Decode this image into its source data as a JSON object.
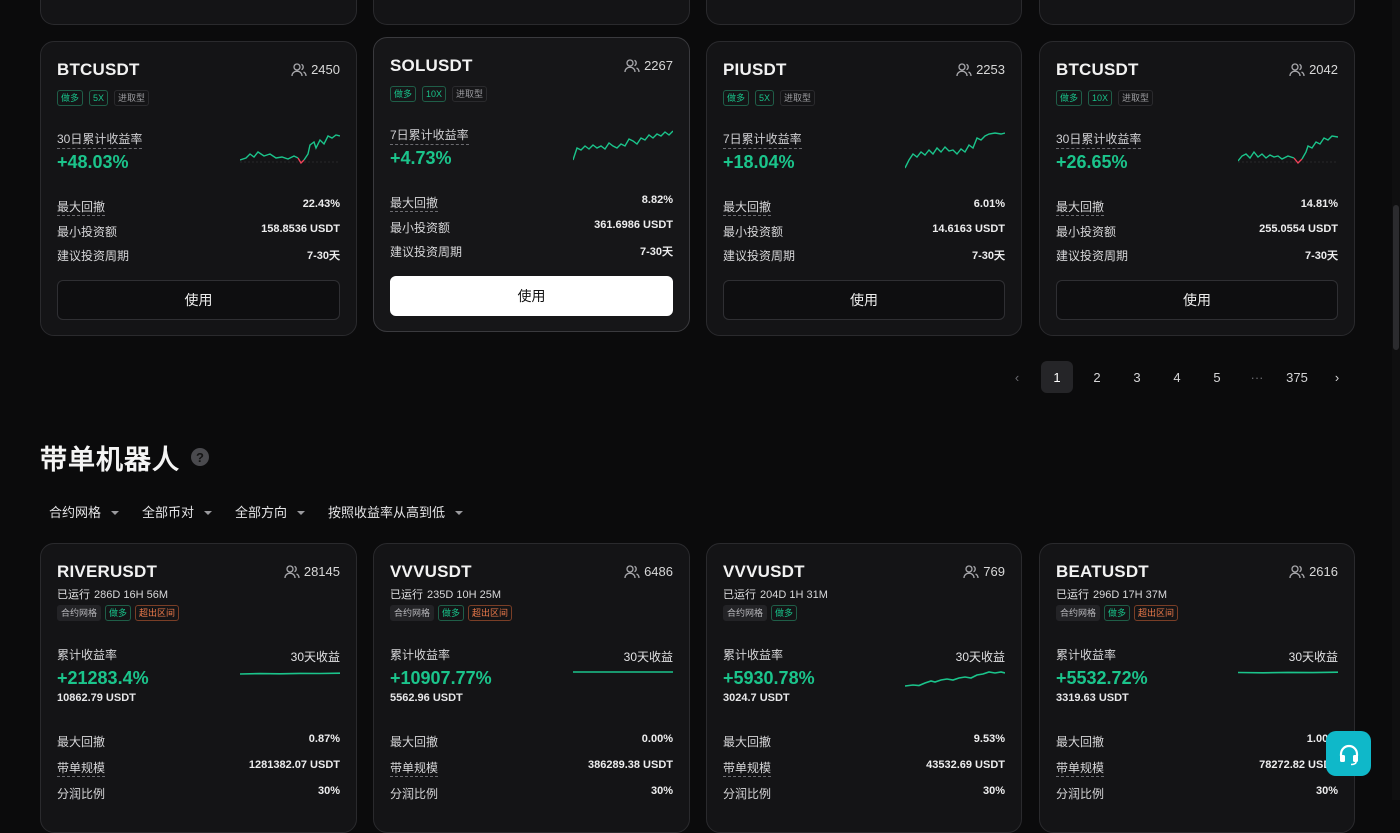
{
  "strategy_cards": [
    {
      "symbol": "BTCUSDT",
      "users": "2450",
      "tags": [
        "做多",
        "5X",
        "进取型"
      ],
      "return_label": "30日累计收益率",
      "return_value": "+48.03%",
      "rows": [
        {
          "k": "最大回撤",
          "v": "22.43%"
        },
        {
          "k": "最小投资额",
          "v": "158.8536 USDT"
        },
        {
          "k": "建议投资周期",
          "v": "7-30天"
        }
      ],
      "button": "使用"
    },
    {
      "symbol": "SOLUSDT",
      "users": "2267",
      "tags": [
        "做多",
        "10X",
        "进取型"
      ],
      "return_label": "7日累计收益率",
      "return_value": "+4.73%",
      "rows": [
        {
          "k": "最大回撤",
          "v": "8.82%"
        },
        {
          "k": "最小投资额",
          "v": "361.6986 USDT"
        },
        {
          "k": "建议投资周期",
          "v": "7-30天"
        }
      ],
      "button": "使用"
    },
    {
      "symbol": "PIUSDT",
      "users": "2253",
      "tags": [
        "做多",
        "5X",
        "进取型"
      ],
      "return_label": "7日累计收益率",
      "return_value": "+18.04%",
      "rows": [
        {
          "k": "最大回撤",
          "v": "6.01%"
        },
        {
          "k": "最小投资额",
          "v": "14.6163 USDT"
        },
        {
          "k": "建议投资周期",
          "v": "7-30天"
        }
      ],
      "button": "使用"
    },
    {
      "symbol": "BTCUSDT",
      "users": "2042",
      "tags": [
        "做多",
        "10X",
        "进取型"
      ],
      "return_label": "30日累计收益率",
      "return_value": "+26.65%",
      "rows": [
        {
          "k": "最大回撤",
          "v": "14.81%"
        },
        {
          "k": "最小投资额",
          "v": "255.0554 USDT"
        },
        {
          "k": "建议投资周期",
          "v": "7-30天"
        }
      ],
      "button": "使用"
    }
  ],
  "pagination": {
    "prev": "‹",
    "pages": [
      "1",
      "2",
      "3",
      "4",
      "5"
    ],
    "ellipsis": "···",
    "last": "375",
    "next": "›",
    "current": "1"
  },
  "section": {
    "title": "带单机器人",
    "help": "?"
  },
  "filters": [
    "合约网格",
    "全部币对",
    "全部方向",
    "按照收益率从高到低"
  ],
  "bot_cards": [
    {
      "symbol": "RIVERUSDT",
      "users": "28145",
      "running_label": "已运行",
      "running": "286D 16H 56M",
      "tags": [
        "合约网格",
        "做多",
        "超出区间"
      ],
      "return_label": "累计收益率",
      "return_value": "+21283.4%",
      "return_usdt": "10862.79 USDT",
      "spark_label": "30天收益",
      "rows": [
        {
          "k": "最大回撤",
          "v": "0.87%"
        },
        {
          "k": "带单规模",
          "v": "1281382.07 USDT"
        },
        {
          "k": "分润比例",
          "v": "30%"
        }
      ]
    },
    {
      "symbol": "VVVUSDT",
      "users": "6486",
      "running_label": "已运行",
      "running": "235D 10H 25M",
      "tags": [
        "合约网格",
        "做多",
        "超出区间"
      ],
      "return_label": "累计收益率",
      "return_value": "+10907.77%",
      "return_usdt": "5562.96 USDT",
      "spark_label": "30天收益",
      "rows": [
        {
          "k": "最大回撤",
          "v": "0.00%"
        },
        {
          "k": "带单规模",
          "v": "386289.38 USDT"
        },
        {
          "k": "分润比例",
          "v": "30%"
        }
      ]
    },
    {
      "symbol": "VVVUSDT",
      "users": "769",
      "running_label": "已运行",
      "running": "204D 1H 31M",
      "tags": [
        "合约网格",
        "做多"
      ],
      "return_label": "累计收益率",
      "return_value": "+5930.78%",
      "return_usdt": "3024.7 USDT",
      "spark_label": "30天收益",
      "rows": [
        {
          "k": "最大回撤",
          "v": "9.53%"
        },
        {
          "k": "带单规模",
          "v": "43532.69 USDT"
        },
        {
          "k": "分润比例",
          "v": "30%"
        }
      ]
    },
    {
      "symbol": "BEATUSDT",
      "users": "2616",
      "running_label": "已运行",
      "running": "296D 17H 37M",
      "tags": [
        "合约网格",
        "做多",
        "超出区间"
      ],
      "return_label": "累计收益率",
      "return_value": "+5532.72%",
      "return_usdt": "3319.63 USDT",
      "spark_label": "30天收益",
      "rows": [
        {
          "k": "最大回撤",
          "v": "1.00%"
        },
        {
          "k": "带单规模",
          "v": "78272.82 USDT"
        },
        {
          "k": "分润比例",
          "v": "30%"
        }
      ]
    }
  ],
  "colors": {
    "positive": "#1bc48b",
    "negative": "#f0435a",
    "accent_support": "#0fb8c9"
  },
  "icons": {
    "users": "users-icon",
    "help": "help-circle-icon",
    "support": "headset-icon",
    "caret": "caret-down-icon"
  }
}
